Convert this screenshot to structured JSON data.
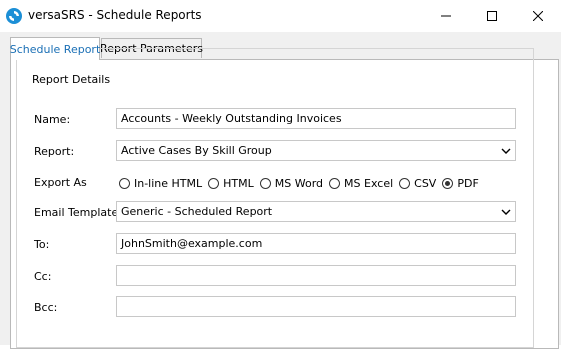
{
  "window": {
    "title": "versaSRS - Schedule Reports",
    "controls": {
      "minimize": "minimize",
      "maximize": "maximize",
      "close": "close"
    }
  },
  "tabs": [
    {
      "label": "Schedule Report",
      "active": true
    },
    {
      "label": "Report Parameters",
      "active": false
    }
  ],
  "report_details": {
    "legend": "Report Details",
    "name": {
      "label": "Name:",
      "value": "Accounts - Weekly Outstanding Invoices"
    },
    "report": {
      "label": "Report:",
      "value": "Active Cases By Skill Group"
    },
    "export_as": {
      "label": "Export As",
      "options": [
        {
          "label": "In-line HTML",
          "selected": false
        },
        {
          "label": "HTML",
          "selected": false
        },
        {
          "label": "MS Word",
          "selected": false
        },
        {
          "label": "MS Excel",
          "selected": false
        },
        {
          "label": "CSV",
          "selected": false
        },
        {
          "label": "PDF",
          "selected": true
        }
      ]
    },
    "email_template": {
      "label": "Email Template:",
      "value": "Generic - Scheduled Report"
    },
    "to": {
      "label": "To:",
      "value": "JohnSmith@example.com"
    },
    "cc": {
      "label": "Cc:",
      "value": ""
    },
    "bcc": {
      "label": "Bcc:",
      "value": ""
    }
  },
  "colors": {
    "active_tab_text": "#1a6fb5",
    "app_icon": "#1c8fd6",
    "panel_bg": "#f0f0f0"
  }
}
